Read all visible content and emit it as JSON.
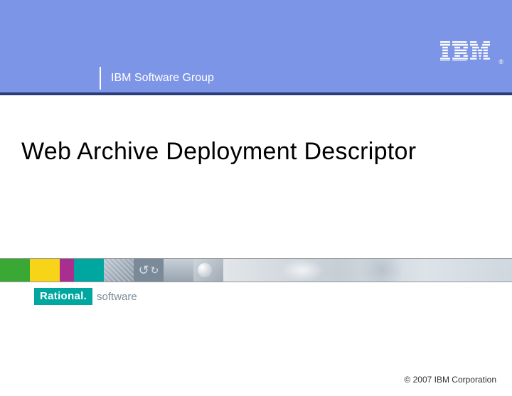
{
  "header": {
    "group_label": "IBM Software Group",
    "logo_name": "IBM"
  },
  "main": {
    "title": "Web Archive Deployment Descriptor"
  },
  "branding": {
    "rational": "Rational.",
    "software": "software"
  },
  "footer": {
    "copyright": "© 2007 IBM Corporation"
  }
}
